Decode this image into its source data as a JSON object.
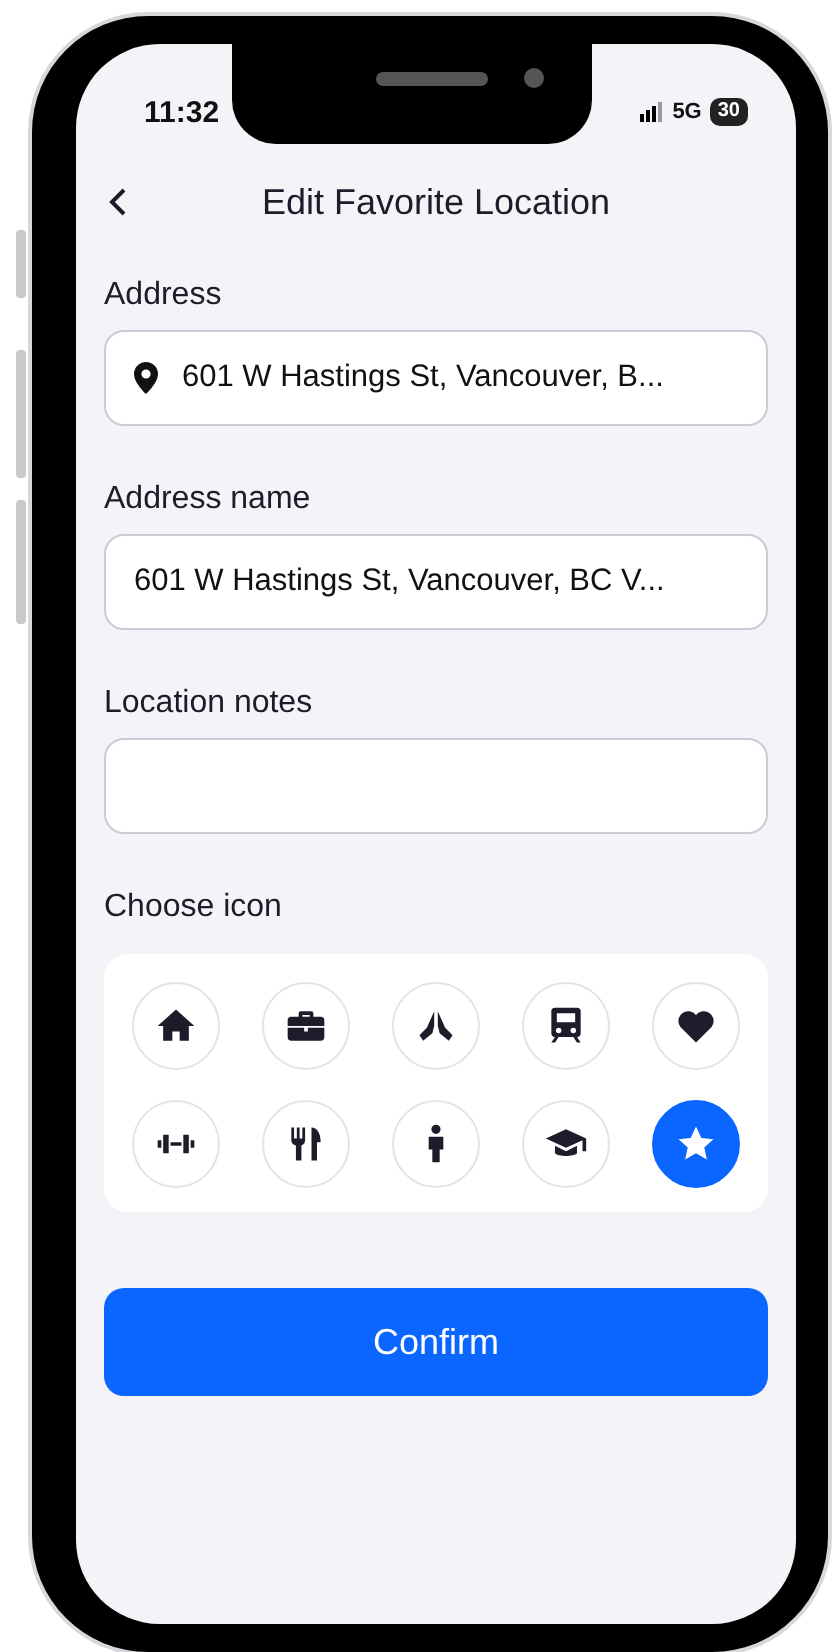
{
  "status_bar": {
    "time": "11:32",
    "network": "5G",
    "battery": "30"
  },
  "header": {
    "title": "Edit Favorite Location"
  },
  "fields": [
    {
      "kind": "address",
      "label": "Address",
      "value": "601 W Hastings St, Vancouver, B..."
    },
    {
      "kind": "text",
      "label": "Address name",
      "value": "601 W Hastings St, Vancouver, BC V..."
    },
    {
      "kind": "text",
      "label": "Location notes"
    }
  ],
  "icon_picker": {
    "label": "Choose icon",
    "icons": [
      {
        "kind": "home",
        "selected": false
      },
      {
        "kind": "briefcase",
        "selected": false
      },
      {
        "kind": "hands",
        "selected": false
      },
      {
        "kind": "train",
        "selected": false
      },
      {
        "kind": "heart",
        "selected": false
      },
      {
        "kind": "dumbbell",
        "selected": false
      },
      {
        "kind": "cutlery",
        "selected": false
      },
      {
        "kind": "person",
        "selected": false
      },
      {
        "kind": "cap",
        "selected": false
      },
      {
        "kind": "star",
        "selected": true
      }
    ]
  },
  "confirm_button": {
    "label": "Confirm"
  }
}
